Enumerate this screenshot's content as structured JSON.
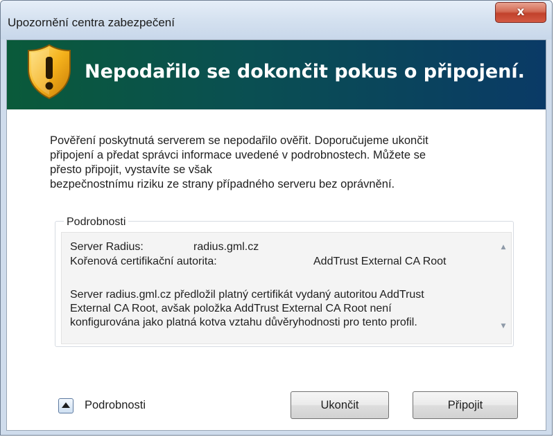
{
  "window": {
    "title": "Upozornění centra zabezpečení",
    "close_label": "x"
  },
  "banner": {
    "title": "Nepodařilo se dokončit pokus o připojení.",
    "icon": "shield-warning-icon"
  },
  "message": {
    "lines": [
      "Pověření poskytnutá serverem se nepodařilo ověřit. Doporučujeme ukončit",
      "připojení a předat správci informace uvedené v podrobnostech. Můžete se",
      "přesto připojit, vystavíte se však",
      "bezpečnostnímu riziku ze strany případného serveru bez oprávnění."
    ]
  },
  "details": {
    "legend": "Podrobnosti",
    "server_label": "Server Radius:",
    "server_value": "radius.gml.cz",
    "ca_label": "Kořenová certifikační autorita:",
    "ca_value": "AddTrust External CA Root",
    "description_lines": [
      "Server radius.gml.cz předložil platný certifikát vydaný autoritou AddTrust",
      "External CA Root, avšak položka AddTrust External CA Root není",
      "konfigurována jako platná kotva vztahu důvěryhodnosti pro tento profil."
    ],
    "scroll_up": "▲",
    "scroll_down": "▼"
  },
  "footer": {
    "toggle_label": "Podrobnosti",
    "cancel_button": "Ukončit",
    "connect_button": "Připojit"
  }
}
